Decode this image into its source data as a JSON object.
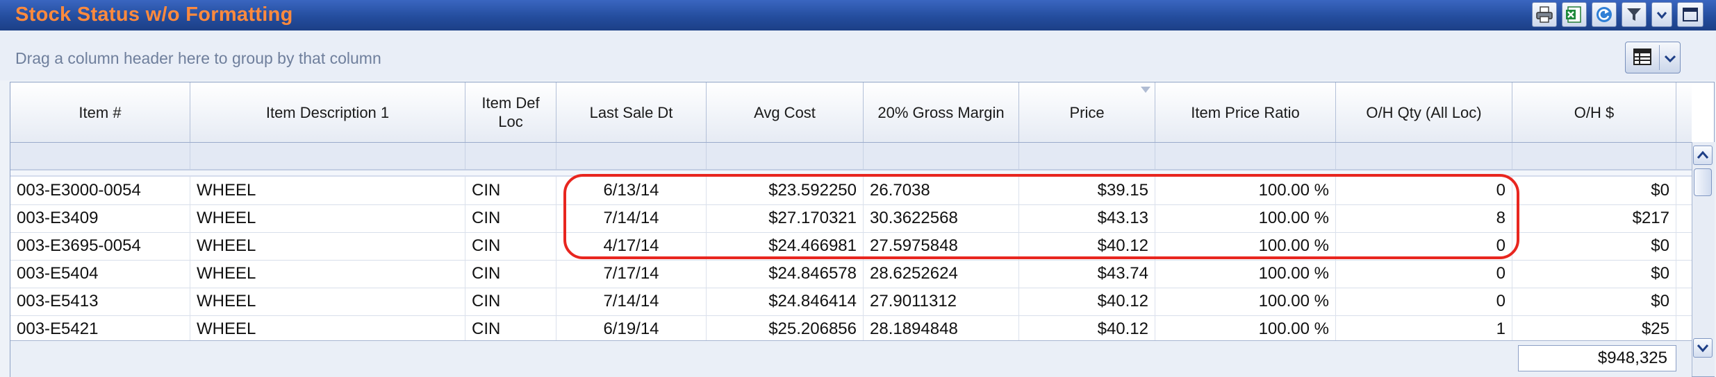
{
  "window": {
    "title": "Stock Status w/o Formatting",
    "toolbar": [
      {
        "name": "print-button",
        "icon": "printer-icon"
      },
      {
        "name": "excel-export-button",
        "icon": "excel-icon"
      },
      {
        "name": "refresh-button",
        "icon": "refresh-icon"
      },
      {
        "name": "filter-button",
        "icon": "funnel-icon"
      },
      {
        "name": "dropdown-button",
        "icon": "chevron-down-icon"
      },
      {
        "name": "maximize-button",
        "icon": "maximize-icon"
      }
    ]
  },
  "group_panel": {
    "hint": "Drag a column header here to group by that column",
    "view_button_icon": "grid-view-icon"
  },
  "table": {
    "columns": [
      "Item #",
      "Item Description 1",
      "Item Def Loc",
      "Last Sale Dt",
      "Avg Cost",
      "20% Gross Margin",
      "Price",
      "Item Price Ratio",
      "O/H Qty (All Loc)",
      "O/H $"
    ],
    "rows": [
      [
        "003-E3000-0054",
        "WHEEL",
        "CIN",
        "6/13/14",
        "$23.592250",
        "26.7038",
        "$39.15",
        "100.00 %",
        "0",
        "$0"
      ],
      [
        "003-E3409",
        "WHEEL",
        "CIN",
        "7/14/14",
        "$27.170321",
        "30.3622568",
        "$43.13",
        "100.00 %",
        "8",
        "$217"
      ],
      [
        "003-E3695-0054",
        "WHEEL",
        "CIN",
        "4/17/14",
        "$24.466981",
        "27.5975848",
        "$40.12",
        "100.00 %",
        "0",
        "$0"
      ],
      [
        "003-E5404",
        "WHEEL",
        "CIN",
        "7/17/14",
        "$24.846578",
        "28.6252624",
        "$43.74",
        "100.00 %",
        "0",
        "$0"
      ],
      [
        "003-E5413",
        "WHEEL",
        "CIN",
        "7/14/14",
        "$24.846414",
        "27.9011312",
        "$40.12",
        "100.00 %",
        "0",
        "$0"
      ],
      [
        "003-E5421",
        "WHEEL",
        "CIN",
        "6/19/14",
        "$25.206856",
        "28.1894848",
        "$40.12",
        "100.00 %",
        "1",
        "$25"
      ]
    ],
    "total_oh": "$948,325"
  },
  "colors": {
    "title_text": "#ff8a3d",
    "title_bar": "#244d9e",
    "highlight_outline": "#e8261f"
  }
}
